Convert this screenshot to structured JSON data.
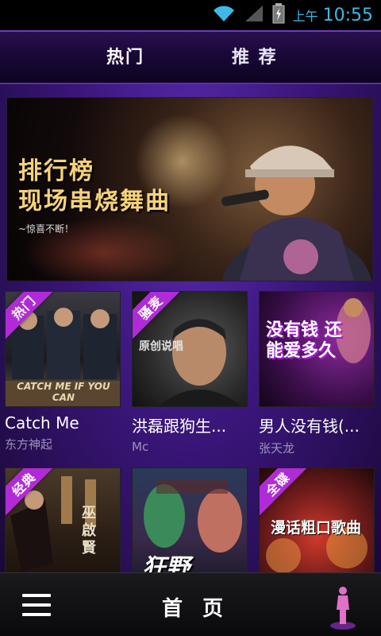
{
  "status": {
    "ampm": "上午",
    "time": "10:55",
    "icons": [
      "wifi-icon",
      "signal-icon",
      "battery-icon"
    ]
  },
  "tabs": [
    {
      "label": "热门"
    },
    {
      "label": "推 荐"
    }
  ],
  "banner": {
    "title_line1": "排行榜",
    "title_line2": "现场串烧舞曲",
    "subtitle": "~惊喜不断！"
  },
  "cards": [
    {
      "title": "Catch Me",
      "artist": "东方神起",
      "badge": "热门",
      "thumb_text": "CATCH ME IF YOU CAN"
    },
    {
      "title": "洪磊跟狗生...",
      "artist": "Mc",
      "badge": "骚麦",
      "thumb_text": "原创说唱"
    },
    {
      "title": "男人没有钱(...",
      "artist": "张天龙",
      "badge": "",
      "thumb_text": "没有钱 还能爱多久"
    },
    {
      "title": "",
      "artist": "",
      "badge": "经典",
      "thumb_text": "巫啟賢"
    },
    {
      "title": "",
      "artist": "",
      "badge": "",
      "thumb_text": "狂野"
    },
    {
      "title": "",
      "artist": "",
      "badge": "全碟",
      "thumb_text": "漫话粗口歌曲"
    }
  ],
  "bottom_nav": {
    "title": "首 页",
    "menu_icon": "menu-icon",
    "player_icon": "now-playing-icon"
  },
  "colors": {
    "accent_purple": "#b12ad8",
    "status_blue": "#3fb8e8",
    "bg_purple": "#3a167a"
  }
}
